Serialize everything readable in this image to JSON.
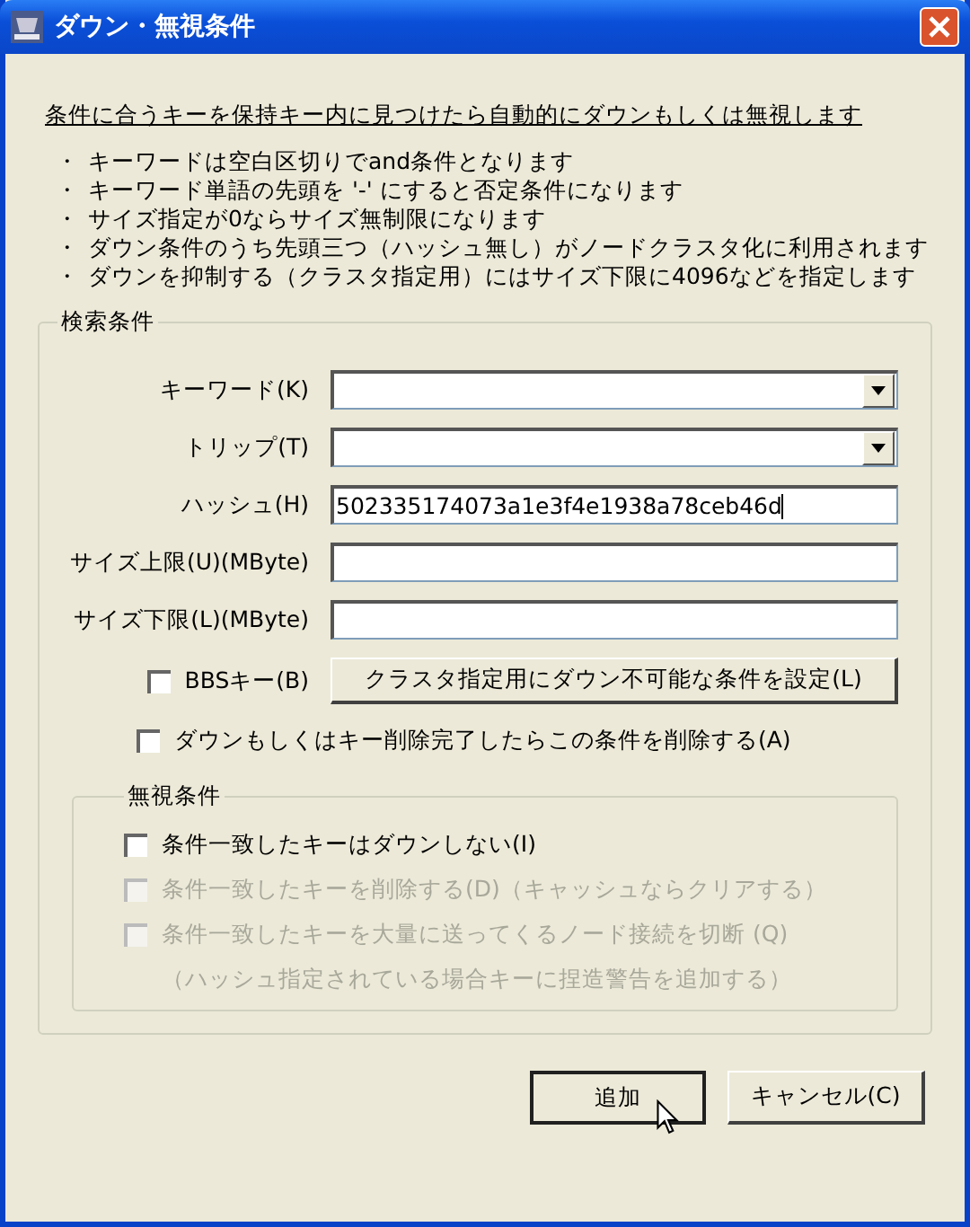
{
  "window": {
    "title": "ダウン・無視条件"
  },
  "intro": "条件に合うキーを保持キー内に見つけたら自動的にダウンもしくは無視します",
  "bullets": [
    {
      "mark": "・",
      "text": "キーワードは空白区切りでand条件となります"
    },
    {
      "mark": "・",
      "text": "キーワード単語の先頭を '-' にすると否定条件になります"
    },
    {
      "mark": "・",
      "text": "サイズ指定が0ならサイズ無制限になります"
    },
    {
      "mark": "・",
      "text": "ダウン条件のうち先頭三つ（ハッシュ無し）がノードクラスタ化に利用されます"
    },
    {
      "mark": "・",
      "text": "ダウンを抑制する（クラスタ指定用）にはサイズ下限に4096などを指定します"
    }
  ],
  "search": {
    "title": "検索条件",
    "fields": [
      {
        "kind": "combo",
        "label": "キーワード(K)"
      },
      {
        "kind": "combo",
        "label": "トリップ(T)"
      },
      {
        "kind": "text",
        "label": "ハッシュ(H)",
        "value": "502335174073a1e3f4e1938a78ceb46d"
      },
      {
        "kind": "text",
        "label": "サイズ上限(U)(MByte)"
      },
      {
        "kind": "text",
        "label": "サイズ下限(L)(MByte)"
      }
    ],
    "bbs": {
      "label": "BBSキー(B)",
      "checked": false
    },
    "cluster_button": "クラスタ指定用にダウン不可能な条件を設定(L)",
    "delete_after": {
      "label": "ダウンもしくはキー削除完了したらこの条件を削除する(A)",
      "checked": false
    },
    "ignore": {
      "title": "無視条件",
      "options": [
        {
          "label": "条件一致したキーはダウンしない(I)",
          "checked": false,
          "disabled": false
        },
        {
          "label": "条件一致したキーを削除する(D)（キャッシュならクリアする）",
          "checked": false,
          "disabled": true
        },
        {
          "label": "条件一致したキーを大量に送ってくるノード接続を切断 (Q)",
          "note": "（ハッシュ指定されている場合キーに捏造警告を追加する）",
          "checked": false,
          "disabled": true
        }
      ]
    }
  },
  "buttons": [
    {
      "label": "追加",
      "default": true
    },
    {
      "label": "キャンセル(C)",
      "default": false
    }
  ]
}
